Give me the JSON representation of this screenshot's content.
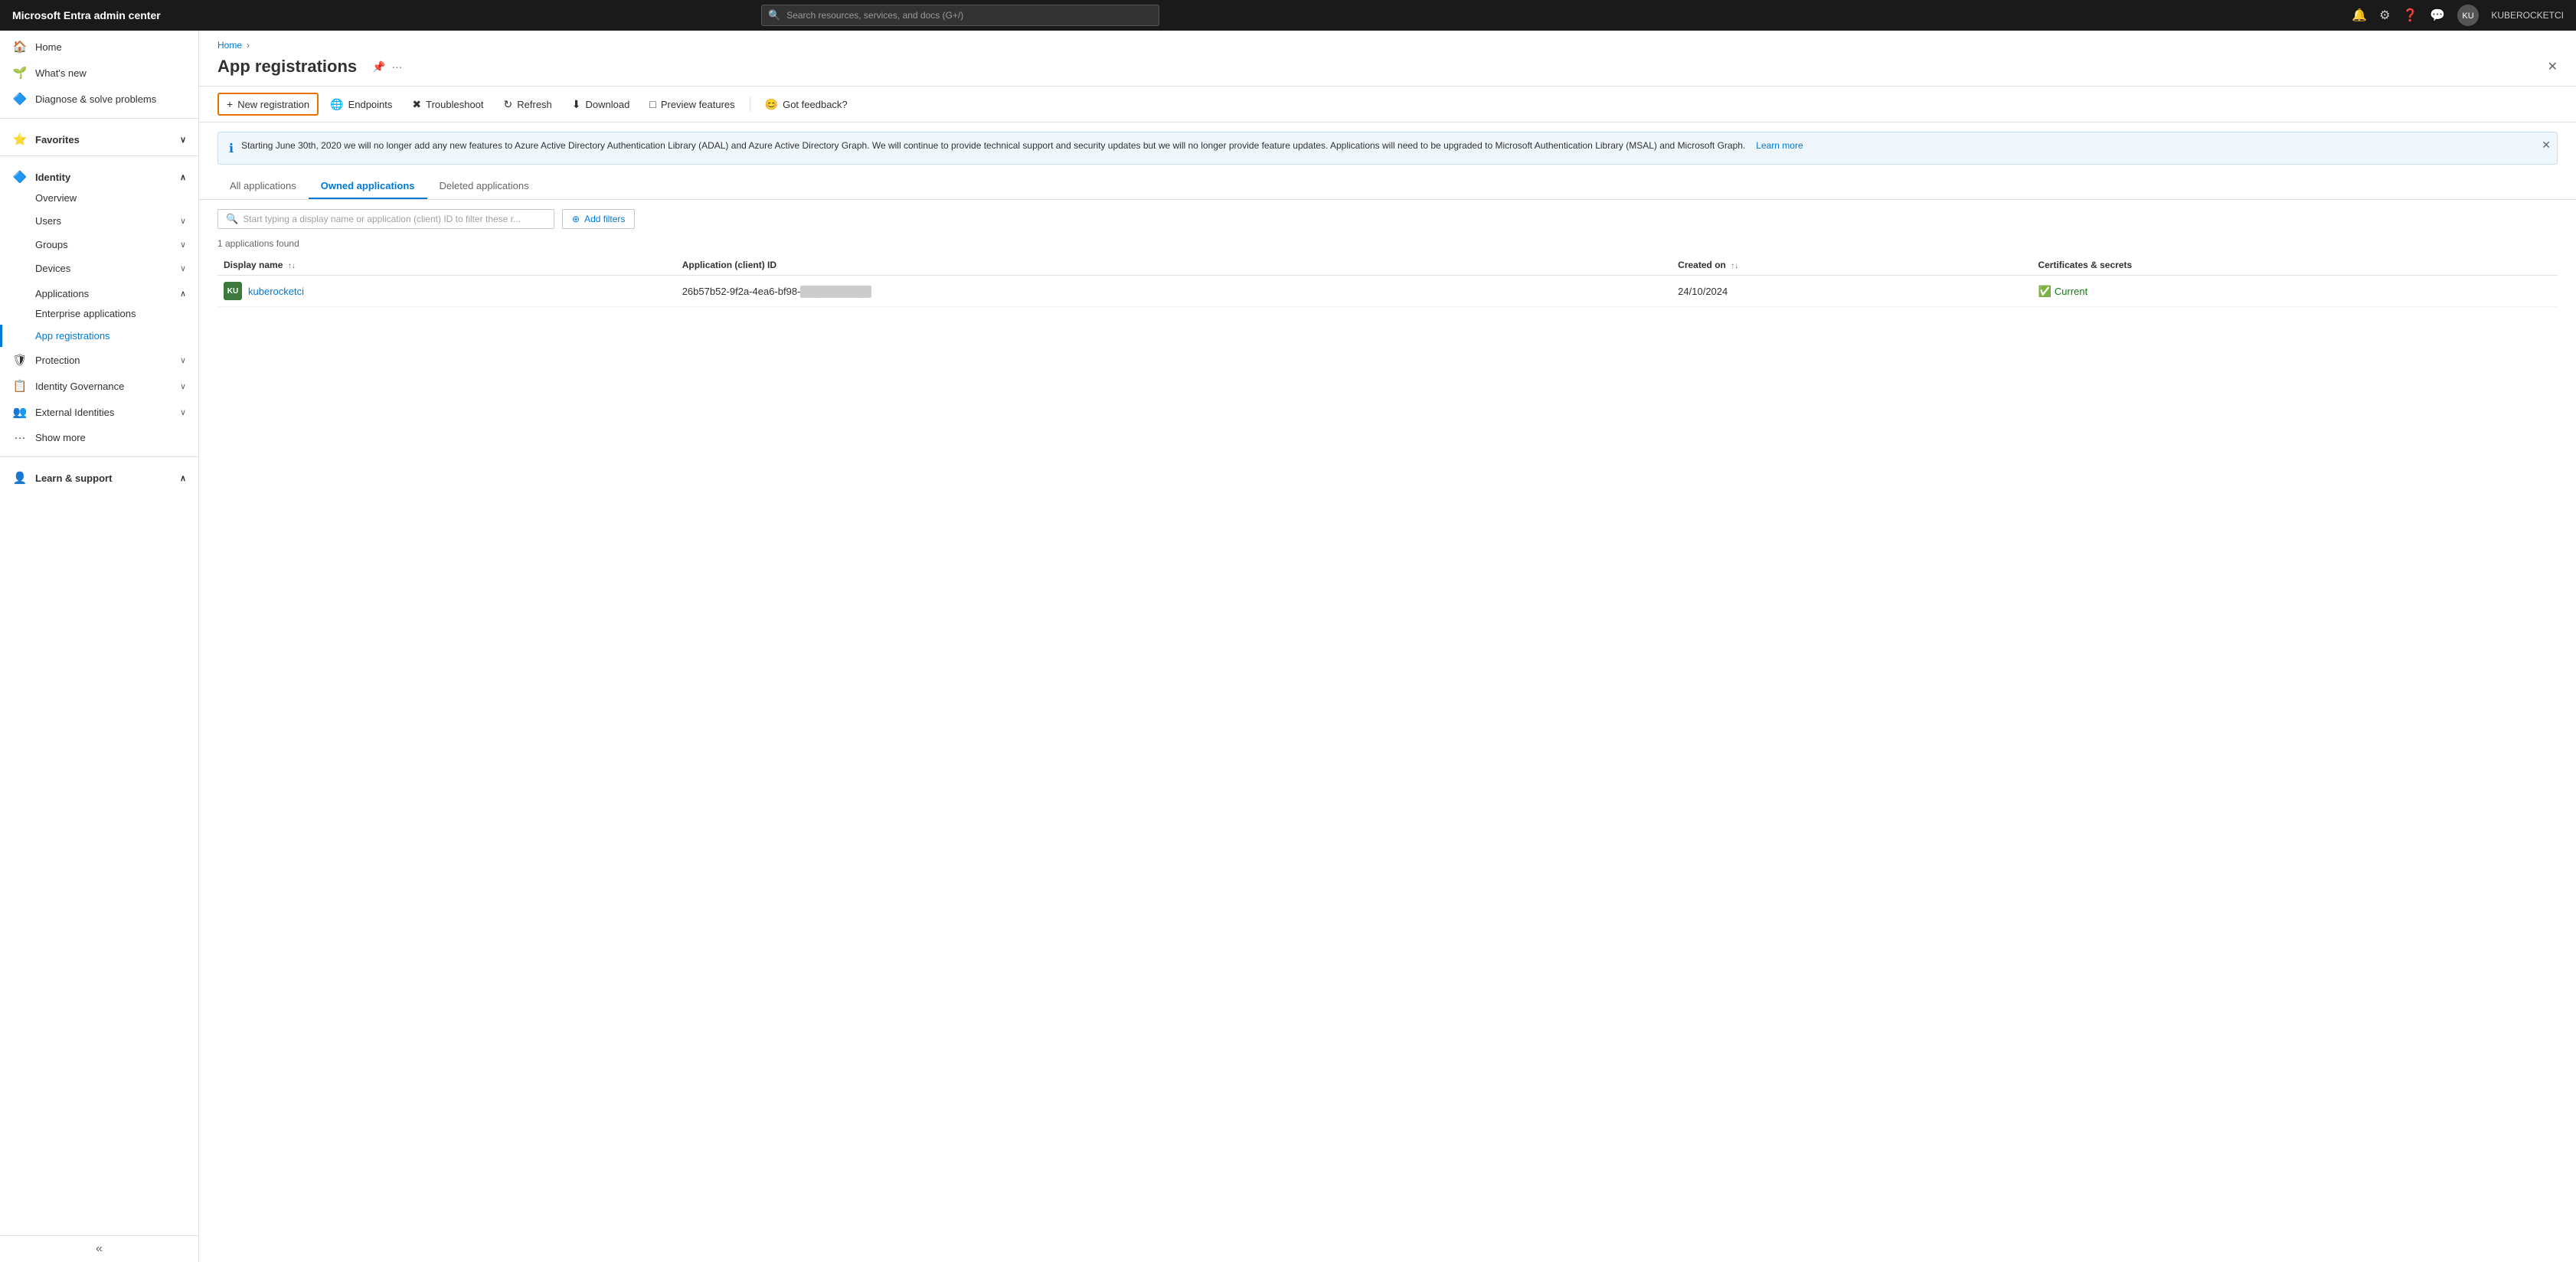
{
  "topbar": {
    "title": "Microsoft Entra admin center",
    "search_placeholder": "Search resources, services, and docs (G+/)",
    "username": "KUBEROCKETCI"
  },
  "sidebar": {
    "home_label": "Home",
    "whats_new_label": "What's new",
    "diagnose_label": "Diagnose & solve problems",
    "favorites_label": "Favorites",
    "identity_label": "Identity",
    "overview_label": "Overview",
    "users_label": "Users",
    "groups_label": "Groups",
    "devices_label": "Devices",
    "applications_label": "Applications",
    "enterprise_apps_label": "Enterprise applications",
    "app_registrations_label": "App registrations",
    "protection_label": "Protection",
    "identity_governance_label": "Identity Governance",
    "external_identities_label": "External Identities",
    "show_more_label": "Show more",
    "learn_support_label": "Learn & support",
    "collapse_label": "«"
  },
  "breadcrumb": {
    "home": "Home"
  },
  "page": {
    "title": "App registrations"
  },
  "toolbar": {
    "new_registration": "New registration",
    "endpoints": "Endpoints",
    "troubleshoot": "Troubleshoot",
    "refresh": "Refresh",
    "download": "Download",
    "preview_features": "Preview features",
    "got_feedback": "Got feedback?"
  },
  "banner": {
    "text": "Starting June 30th, 2020 we will no longer add any new features to Azure Active Directory Authentication Library (ADAL) and Azure Active Directory Graph. We will continue to provide technical support and security updates but we will no longer provide feature updates. Applications will need to be upgraded to Microsoft Authentication Library (MSAL) and Microsoft Graph.",
    "learn_more": "Learn more"
  },
  "tabs": [
    {
      "label": "All applications",
      "active": false
    },
    {
      "label": "Owned applications",
      "active": true
    },
    {
      "label": "Deleted applications",
      "active": false
    }
  ],
  "filter": {
    "placeholder": "Start typing a display name or application (client) ID to filter these r...",
    "add_filters": "Add filters"
  },
  "table": {
    "count_text": "1 applications found",
    "columns": [
      {
        "label": "Display name",
        "sortable": true
      },
      {
        "label": "Application (client) ID",
        "sortable": false
      },
      {
        "label": "Created on",
        "sortable": true
      },
      {
        "label": "Certificates & secrets",
        "sortable": false
      }
    ],
    "rows": [
      {
        "avatar_initials": "KU",
        "avatar_bg": "#3d7a3d",
        "display_name": "kuberocketci",
        "client_id": "26b57b52-9f2a-4ea6-bf98-",
        "client_id_redacted": "██████████",
        "created_on": "24/10/2024",
        "cert_status": "Current",
        "cert_icon": "✓"
      }
    ]
  }
}
